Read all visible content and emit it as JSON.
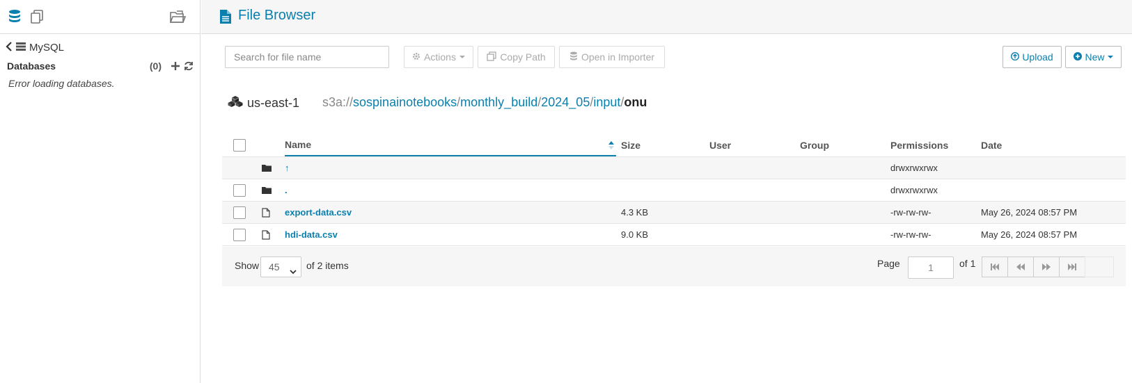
{
  "sidebar": {
    "back_label": "MySQL",
    "databases_title": "Databases",
    "databases_count": "(0)",
    "error_message": "Error loading databases.",
    "icons": [
      "database-icon",
      "documents-icon",
      "folder-open-icon",
      "chevron-left-icon",
      "server-icon",
      "plus-icon",
      "refresh-icon"
    ]
  },
  "header": {
    "title": "File Browser",
    "icon": "file-text-icon"
  },
  "toolbar": {
    "search_placeholder": "Search for file name",
    "actions_label": "Actions",
    "copy_path_label": "Copy Path",
    "open_importer_label": "Open in Importer",
    "upload_label": "Upload",
    "new_label": "New"
  },
  "location": {
    "region": "us-east-1",
    "scheme": "s3a://",
    "path_segments": [
      "sospinainotebooks",
      "monthly_build",
      "2024_05",
      "input"
    ],
    "current": "onu"
  },
  "table": {
    "columns": {
      "name": "Name",
      "size": "Size",
      "user": "User",
      "group": "Group",
      "permissions": "Permissions",
      "date": "Date"
    },
    "rows": [
      {
        "type": "folder",
        "name": "↑",
        "size": "",
        "user": "",
        "group": "",
        "permissions": "drwxrwxrwx",
        "date": ""
      },
      {
        "type": "folder",
        "name": ".",
        "size": "",
        "user": "",
        "group": "",
        "permissions": "drwxrwxrwx",
        "date": ""
      },
      {
        "type": "file",
        "name": "export-data.csv",
        "size": "4.3 KB",
        "user": "",
        "group": "",
        "permissions": "-rw-rw-rw-",
        "date": "May 26, 2024 08:57 PM"
      },
      {
        "type": "file",
        "name": "hdi-data.csv",
        "size": "9.0 KB",
        "user": "",
        "group": "",
        "permissions": "-rw-rw-rw-",
        "date": "May 26, 2024 08:57 PM"
      }
    ]
  },
  "pagination": {
    "show_label": "Show",
    "page_size": "45",
    "items_label": "of 2 items",
    "page_label": "Page",
    "page_value": "1",
    "of_pages": "of 1"
  },
  "colors": {
    "accent": "#0b7fad",
    "header_bg": "#f6f6f7"
  }
}
